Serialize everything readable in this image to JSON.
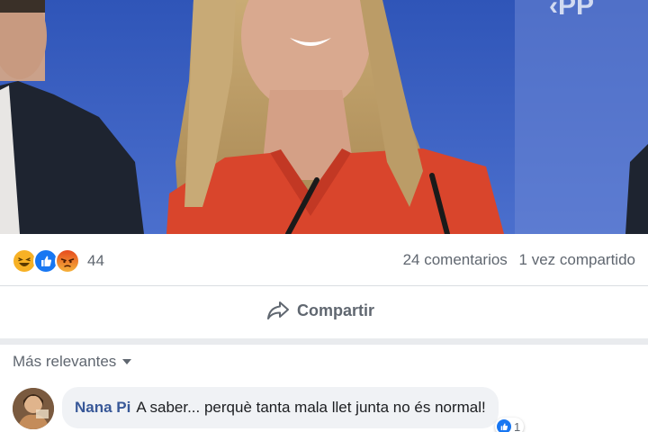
{
  "post": {
    "photo_alt": "",
    "reactions": {
      "icons": [
        "haha-icon",
        "like-icon",
        "angry-icon"
      ],
      "count": "44"
    },
    "stats": {
      "comments": "24 comentarios",
      "shares": "1 vez compartido"
    },
    "actions": {
      "share_label": "Compartir"
    }
  },
  "comments": {
    "sort_label": "Más relevantes",
    "items": [
      {
        "author": "Nana Pi",
        "text": "A saber... perquè tanta mala llet junta no és normal!",
        "reaction_icon": "like-icon",
        "reaction_count": "1"
      }
    ]
  },
  "colors": {
    "brand": "#385898",
    "text_secondary": "#606770",
    "divider": "#dadde1",
    "like_blue": "#1877f2",
    "angry_orange": "#e9710f",
    "haha_yellow": "#f7b125"
  }
}
